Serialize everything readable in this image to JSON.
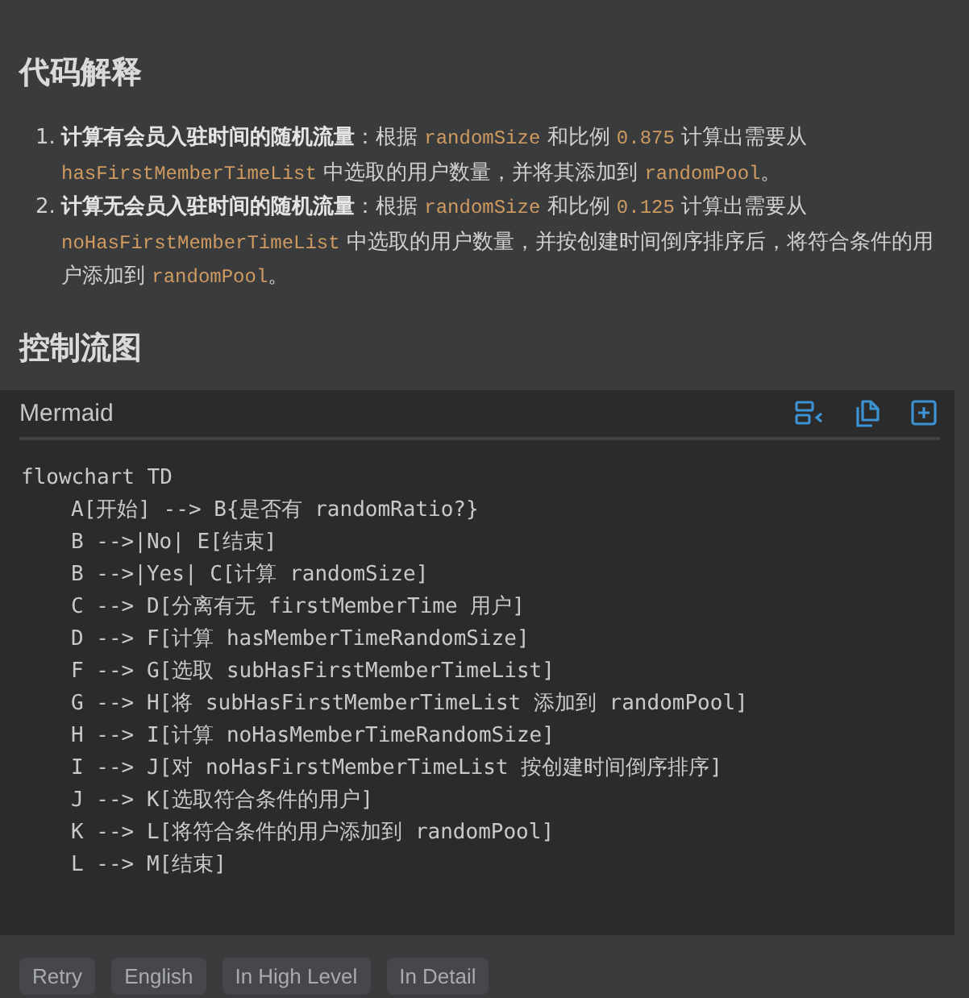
{
  "explanation": {
    "heading": "代码解释",
    "items": [
      {
        "number": "1.",
        "parts": [
          {
            "kind": "bold",
            "text": "计算有会员入驻时间的随机流量"
          },
          {
            "kind": "plain",
            "text": "：根据 "
          },
          {
            "kind": "code",
            "text": "randomSize"
          },
          {
            "kind": "plain",
            "text": " 和比例 "
          },
          {
            "kind": "code",
            "text": "0.875"
          },
          {
            "kind": "plain",
            "text": " 计算出需要从 "
          },
          {
            "kind": "code",
            "text": "hasFirstMemberTimeList"
          },
          {
            "kind": "plain",
            "text": " 中选取的用户数量，并将其添加到 "
          },
          {
            "kind": "code",
            "text": "randomPool"
          },
          {
            "kind": "plain",
            "text": "。"
          }
        ]
      },
      {
        "number": "2.",
        "parts": [
          {
            "kind": "bold",
            "text": "计算无会员入驻时间的随机流量"
          },
          {
            "kind": "plain",
            "text": "：根据 "
          },
          {
            "kind": "code",
            "text": "randomSize"
          },
          {
            "kind": "plain",
            "text": " 和比例 "
          },
          {
            "kind": "code",
            "text": "0.125"
          },
          {
            "kind": "plain",
            "text": " 计算出需要从 "
          },
          {
            "kind": "code",
            "text": "noHasFirstMemberTimeList"
          },
          {
            "kind": "plain",
            "text": " 中选取的用户数量，并按创建时间倒序排序后，将符合条件的用户添加到 "
          },
          {
            "kind": "code",
            "text": "randomPool"
          },
          {
            "kind": "plain",
            "text": "。"
          }
        ]
      }
    ]
  },
  "flow": {
    "heading": "控制流图"
  },
  "code_block": {
    "language": "Mermaid",
    "lines": [
      {
        "text": "flowchart TD",
        "children": [
          {
            "text": "A[开始] --> B{是否有 randomRatio?}"
          },
          {
            "text": "B -->|No| E[结束]"
          },
          {
            "text": "B -->|Yes| C[计算 randomSize]"
          },
          {
            "text": "C --> D[分离有无 firstMemberTime 用户]"
          },
          {
            "text": "D --> F[计算 hasMemberTimeRandomSize]"
          },
          {
            "text": "F --> G[选取 subHasFirstMemberTimeList]"
          },
          {
            "text": "G --> H[将 subHasFirstMemberTimeList 添加到 randomPool]"
          },
          {
            "text": "H --> I[计算 noHasMemberTimeRandomSize]"
          },
          {
            "text": "I --> J[对 noHasFirstMemberTimeList 按创建时间倒序排序]"
          },
          {
            "text": "J --> K[选取符合条件的用户]"
          },
          {
            "text": "K --> L[将符合条件的用户添加到 randomPool]"
          },
          {
            "text": "L --> M[结束]"
          }
        ]
      }
    ]
  },
  "actions": [
    "Retry",
    "English",
    "In High Level",
    "In Detail"
  ]
}
